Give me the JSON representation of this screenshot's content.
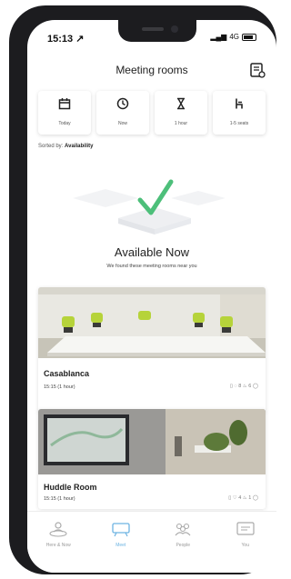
{
  "status_bar": {
    "time": "15:13 ↗",
    "signal": "4G"
  },
  "header": {
    "title": "Meeting rooms",
    "menu_icon": "list-icon"
  },
  "filters": [
    {
      "label": "Today",
      "icon": "calendar-icon"
    },
    {
      "label": "Now",
      "icon": "clock-icon"
    },
    {
      "label": "1 hour",
      "icon": "hourglass-icon"
    },
    {
      "label": "1-5 seats",
      "icon": "chair-icon"
    }
  ],
  "sort": {
    "prefix": "Sorted by:",
    "value": "Availability"
  },
  "availability": {
    "title": "Available Now",
    "subtitle": "We found these meeting rooms near you"
  },
  "rooms": [
    {
      "name": "Casablanca",
      "time": "15:15 (1 hour)",
      "amenities": "▯ ◌ 8 ♨ 6 ◯"
    },
    {
      "name": "Huddle Room",
      "time": "15:15 (1 hour)",
      "amenities": "▯ ♡ 4 ♨ 1 ◯"
    }
  ],
  "tabs": [
    {
      "label": "Here & Now",
      "icon": "person-location-icon"
    },
    {
      "label": "Meet",
      "icon": "meet-icon"
    },
    {
      "label": "People",
      "icon": "people-icon"
    },
    {
      "label": "You",
      "icon": "id-card-icon"
    }
  ],
  "colors": {
    "accent": "#6db4e2",
    "check": "#4dbf7a",
    "chair": "#b6d33a"
  }
}
